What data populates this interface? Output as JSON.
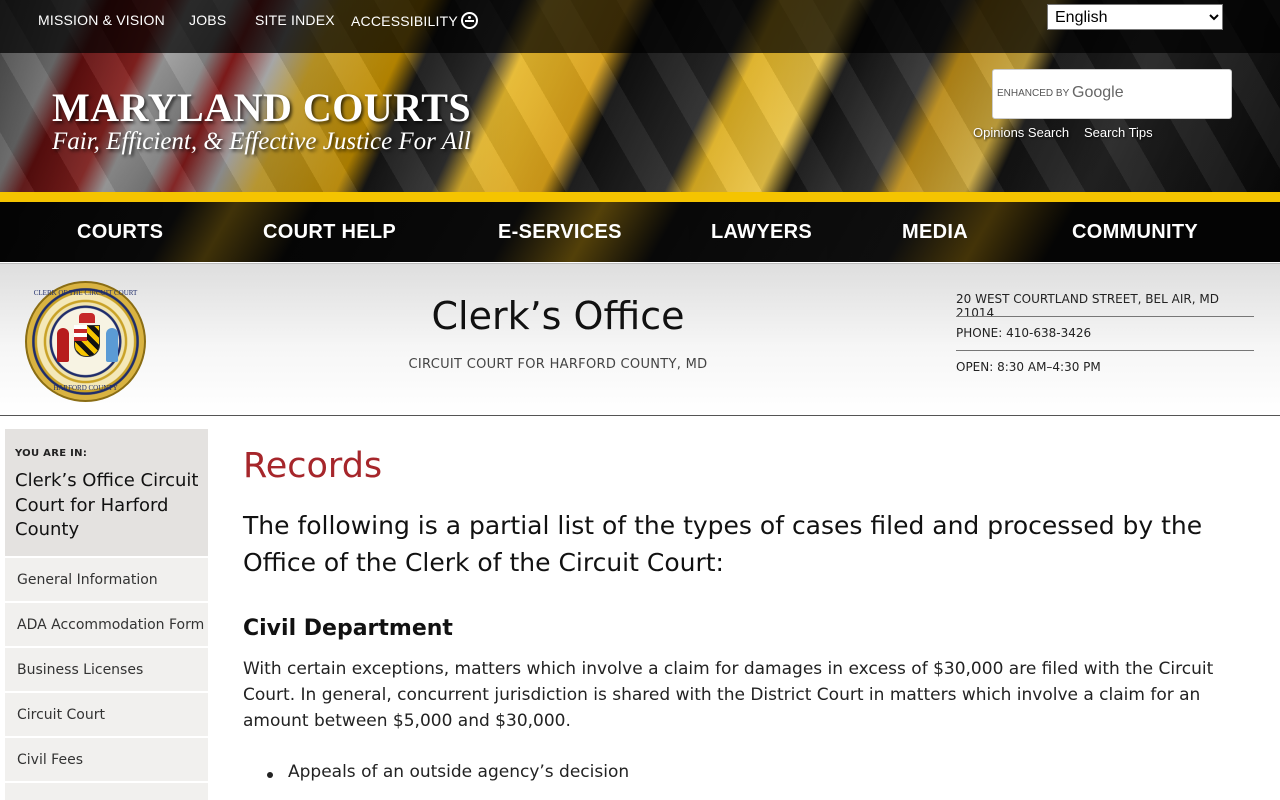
{
  "utility_nav": {
    "mission": "MISSION & VISION",
    "jobs": "JOBS",
    "site_index": "SITE INDEX",
    "accessibility": "ACCESSIBILITY"
  },
  "language": {
    "selected": "English"
  },
  "brand": {
    "title": "MARYLAND COURTS",
    "tagline": "Fair, Efficient, & Effective Justice For All"
  },
  "search": {
    "enhanced_by": "ENHANCED BY",
    "google": "Google",
    "opinions_search": "Opinions Search",
    "search_tips": "Search Tips"
  },
  "main_nav": [
    "COURTS",
    "COURT HELP",
    "E-SERVICES",
    "LAWYERS",
    "MEDIA",
    "COMMUNITY"
  ],
  "banner": {
    "title": "Clerk’s Office",
    "subtitle": "CIRCUIT COURT FOR HARFORD COUNTY, MD",
    "address": "20 WEST COURTLAND STREET, BEL AIR, MD 21014",
    "phone": "PHONE: 410-638-3426",
    "hours": "OPEN: 8:30 AM–4:30 PM",
    "seal_top_text": "CLERK OF THE CIRCUIT COURT",
    "seal_bottom_text": "HARFORD COUNTY"
  },
  "sidebar": {
    "you_are_in": "YOU ARE IN:",
    "current": "Clerk’s Office Circuit Court for Harford County",
    "items": [
      "General Information",
      "ADA Accommodation Form",
      "Business Licenses",
      "Circuit Court",
      "Civil Fees"
    ]
  },
  "main": {
    "title": "Records",
    "intro": "The following is a partial list of the types of cases filed and processed by the Office of the Clerk of the Circuit Court:",
    "section_heading": "Civil Department",
    "paragraph": "With certain exceptions, matters which involve a claim for damages in excess of $30,000 are filed with the Circuit Court. In general, concurrent jurisdiction is shared with the District Court in matters which involve a claim for an amount between $5,000 and $30,000.",
    "bullets": [
      "Appeals of an outside agency’s decision"
    ]
  },
  "colors": {
    "accent_red": "#a6262b",
    "flag_yellow": "#f5c400"
  }
}
